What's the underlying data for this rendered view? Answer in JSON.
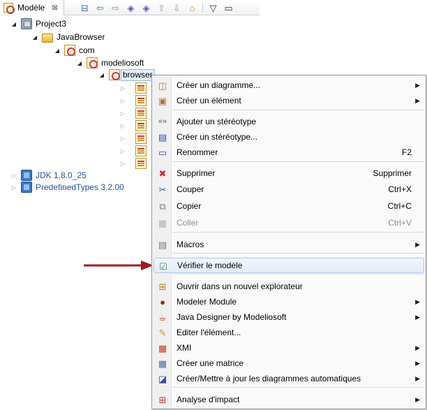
{
  "view": {
    "tab_label": "Modèle",
    "close_glyph": "⊠",
    "toolbar": [
      {
        "icon": "collapse-all-icon",
        "glyph": "⊟",
        "color": "#3b6cb7"
      },
      {
        "icon": "back-icon",
        "glyph": "⇦",
        "color": "#2e9b2e"
      },
      {
        "icon": "forward-icon",
        "glyph": "⇨",
        "color": "#8a8a8a"
      },
      {
        "icon": "link-editor-icon",
        "glyph": "◈",
        "color": "#6a4fc2"
      },
      {
        "icon": "sync-icon",
        "glyph": "◈",
        "color": "#6a4fc2"
      },
      {
        "icon": "up-icon",
        "glyph": "⇧",
        "color": "#a0a0a0"
      },
      {
        "icon": "down-icon",
        "glyph": "⇩",
        "color": "#a0a0a0"
      },
      {
        "icon": "home-icon",
        "glyph": "⌂",
        "color": "#c0862a"
      },
      {
        "icon": "view-menu-icon",
        "glyph": "▽",
        "color": "#333333"
      },
      {
        "icon": "minimize-icon",
        "glyph": "▭",
        "color": "#333333"
      }
    ]
  },
  "tree": {
    "twisty_open": "◢",
    "twisty_closed": "▷",
    "nodes": [
      {
        "label": "Project3"
      },
      {
        "label": "JavaBrowser"
      },
      {
        "label": "com"
      },
      {
        "label": "modeliosoft"
      },
      {
        "label": "browser"
      },
      {
        "label": "JDK 1.8.0_25"
      },
      {
        "label": "PredefinedTypes 3.2.00"
      }
    ],
    "hidden_children_count": 7
  },
  "menu": {
    "submenu_glyph": "▶",
    "items": [
      {
        "label": "Créer un diagramme...",
        "shortcut": "",
        "submenu": true,
        "icon": "diagram-icon",
        "glyph": "◫",
        "color": "#b5851f"
      },
      {
        "label": "Créer un élément",
        "shortcut": "",
        "submenu": true,
        "icon": "element-icon",
        "glyph": "▣",
        "color": "#a87a3a"
      },
      {
        "label": "Ajouter un stéréotype",
        "shortcut": "",
        "submenu": false,
        "icon": "stereotype-add-icon",
        "glyph": "«»",
        "color": "#2e7d2e"
      },
      {
        "label": "Créer un stéréotype...",
        "shortcut": "",
        "submenu": false,
        "icon": "stereotype-create-icon",
        "glyph": "▤",
        "color": "#2a4fa0"
      },
      {
        "label": "Renommer",
        "shortcut": "F2",
        "submenu": false,
        "icon": "rename-icon",
        "glyph": "▭",
        "color": "#2a4fa0"
      },
      {
        "label": "Supprimer",
        "shortcut": "Supprimer",
        "submenu": false,
        "icon": "delete-icon",
        "glyph": "✖",
        "color": "#d03030"
      },
      {
        "label": "Couper",
        "shortcut": "Ctrl+X",
        "submenu": false,
        "icon": "cut-icon",
        "glyph": "✂",
        "color": "#3a5a9a"
      },
      {
        "label": "Copier",
        "shortcut": "Ctrl+C",
        "submenu": false,
        "icon": "copy-icon",
        "glyph": "⧉",
        "color": "#6a7a8a"
      },
      {
        "label": "Coller",
        "shortcut": "Ctrl+V",
        "submenu": false,
        "icon": "paste-icon",
        "glyph": "▦",
        "color": "#b0b0b0",
        "disabled": true
      },
      {
        "label": "Macros",
        "shortcut": "",
        "submenu": true,
        "icon": "macros-icon",
        "glyph": "▤",
        "color": "#6a7a8a"
      },
      {
        "label": "Vérifier le modèle",
        "shortcut": "",
        "submenu": false,
        "icon": "check-model-icon",
        "glyph": "☑",
        "color": "#4a8a4a",
        "highlighted": true
      },
      {
        "label": "Ouvrir dans un nouvel explorateur",
        "shortcut": "",
        "submenu": false,
        "icon": "new-explorer-icon",
        "glyph": "⊞",
        "color": "#b5851f"
      },
      {
        "label": "Modeler Module",
        "shortcut": "",
        "submenu": true,
        "icon": "modeler-module-icon",
        "glyph": "●",
        "color": "#b02020"
      },
      {
        "label": "Java Designer by Modeliosoft",
        "shortcut": "",
        "submenu": true,
        "icon": "java-designer-icon",
        "glyph": "☕",
        "color": "#c0392b"
      },
      {
        "label": "Editer l'élément...",
        "shortcut": "",
        "submenu": false,
        "icon": "edit-element-icon",
        "glyph": "✎",
        "color": "#c9922c"
      },
      {
        "label": "XMI",
        "shortcut": "",
        "submenu": true,
        "icon": "xmi-icon",
        "glyph": "▦",
        "color": "#c0392b"
      },
      {
        "label": "Créer une matrice",
        "shortcut": "",
        "submenu": true,
        "icon": "matrix-icon",
        "glyph": "▦",
        "color": "#4a6aa0"
      },
      {
        "label": "Créer/Mettre à jour les diagrammes automatiques",
        "shortcut": "",
        "submenu": true,
        "icon": "auto-diagrams-icon",
        "glyph": "◪",
        "color": "#2a4fa0"
      },
      {
        "label": "Analyse d'impact",
        "shortcut": "",
        "submenu": true,
        "icon": "impact-analysis-icon",
        "glyph": "⊞",
        "color": "#c0392b"
      }
    ]
  },
  "colors": {
    "arrow": "#a01c1c",
    "link_text": "#2a4fa0",
    "menu_highlight_border": "#a8c5ea"
  }
}
